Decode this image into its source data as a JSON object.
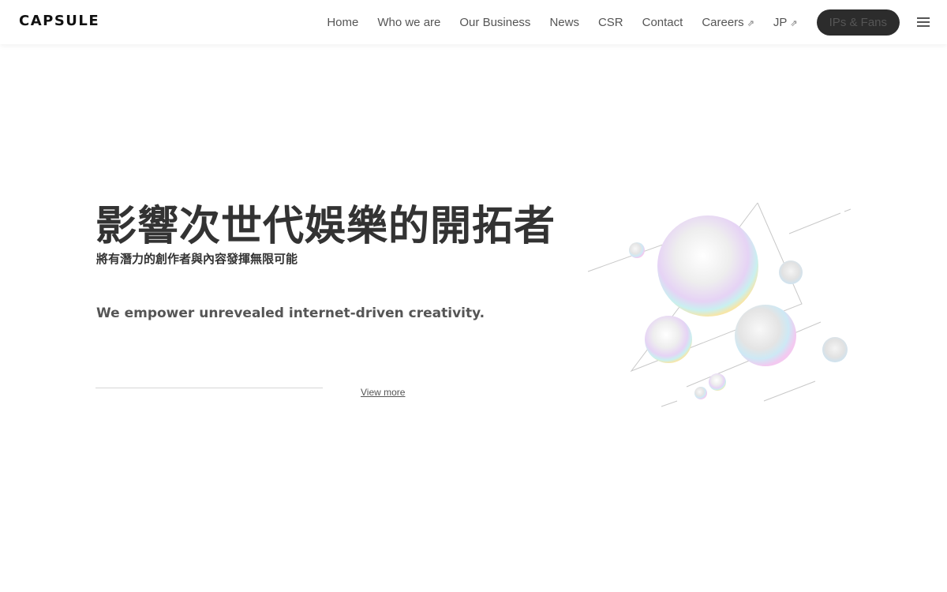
{
  "header": {
    "logo": "CAPSULE",
    "nav": [
      {
        "label": "Home"
      },
      {
        "label": "Who we are"
      },
      {
        "label": "Our Business"
      },
      {
        "label": "News"
      },
      {
        "label": "CSR"
      },
      {
        "label": "Contact"
      },
      {
        "label": "Careers",
        "icon": "external-link-icon"
      },
      {
        "label": "JP",
        "icon": "external-link-icon"
      }
    ],
    "cta_label": "IPs & Fans",
    "menu_icon": "hamburger-menu-icon",
    "external_icon_glyph": "⇗"
  },
  "hero": {
    "title": "影響次世代娛樂的開拓者",
    "subtitle": "將有潛力的創作者與內容發揮無限可能",
    "tagline": "We empower unrevealed internet-driven creativity.",
    "view_more": "View more",
    "illustration": "iridescent-bubbles-illustration"
  },
  "colors": {
    "text": "#333333",
    "muted": "#555555",
    "cta_bg": "#2c2c2c",
    "cta_text": "#ffffff",
    "background": "#ffffff"
  }
}
